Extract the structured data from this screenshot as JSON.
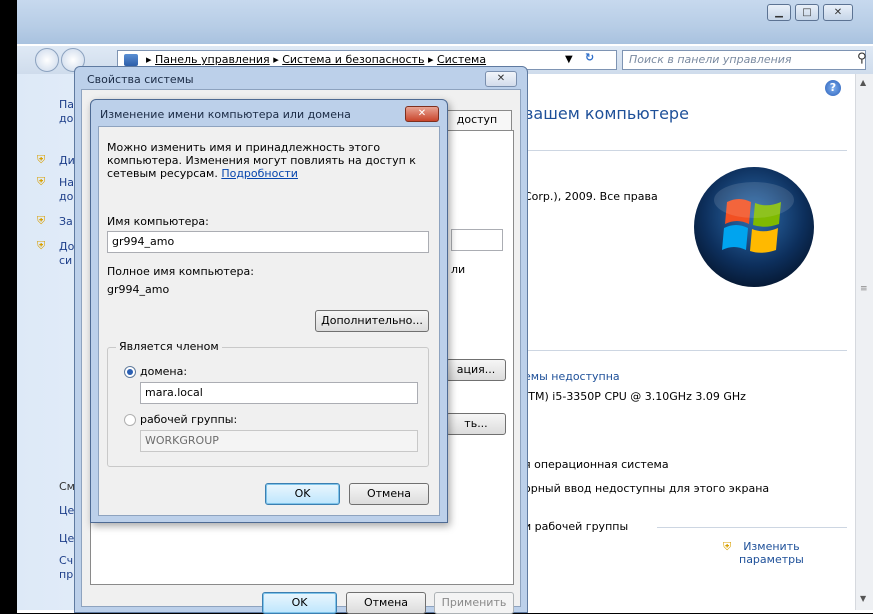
{
  "control_panel": {
    "breadcrumb": [
      "Панель управления",
      "Система и безопасность",
      "Система"
    ],
    "search_placeholder": "Поиск в панели управления",
    "heading_fragment": "вашем компьютере",
    "copyright_fragment": "Corp.), 2009. Все права",
    "rating_fragment": "емы недоступна",
    "cpu_fragment": "(TM) i5-3350P CPU @ 3.10GHz  3.09 GHz",
    "os_fragment": "я операционная система",
    "touch_fragment": "орный ввод недоступны для этого экрана",
    "workgroup_fragment": "и рабочей группы",
    "change_label_line1": "Изменить",
    "change_label_line2": "параметры",
    "sidebar_fragments": [
      "Па",
      "до",
      "Ди",
      "На",
      "до",
      "За",
      "До",
      "си",
      "См",
      "Це",
      "Це",
      "Сч",
      "пр"
    ]
  },
  "system_properties": {
    "title": "Свойства системы",
    "tab_fragment": "доступ",
    "behind_text_fragment": "ли",
    "button_fragment_1": "ация...",
    "button_fragment_2": "ть...",
    "ok_label": "OK",
    "cancel_label": "Отмена",
    "apply_label": "Применить"
  },
  "rename_dialog": {
    "title": "Изменение имени компьютера или домена",
    "description": "Можно изменить имя и принадлежность этого компьютера. Изменения могут повлиять на доступ к сетевым ресурсам.",
    "details_link": "Подробности",
    "computer_name_label": "Имя компьютера:",
    "computer_name_value": "gr994_amo",
    "full_name_label": "Полное имя компьютера:",
    "full_name_value": "gr994_amo",
    "more_button": "Дополнительно...",
    "member_of_label": "Является членом",
    "domain_label": "домена:",
    "domain_value": "mara.local",
    "workgroup_label": "рабочей группы:",
    "workgroup_value": "WORKGROUP",
    "ok_label": "OK",
    "cancel_label": "Отмена"
  }
}
